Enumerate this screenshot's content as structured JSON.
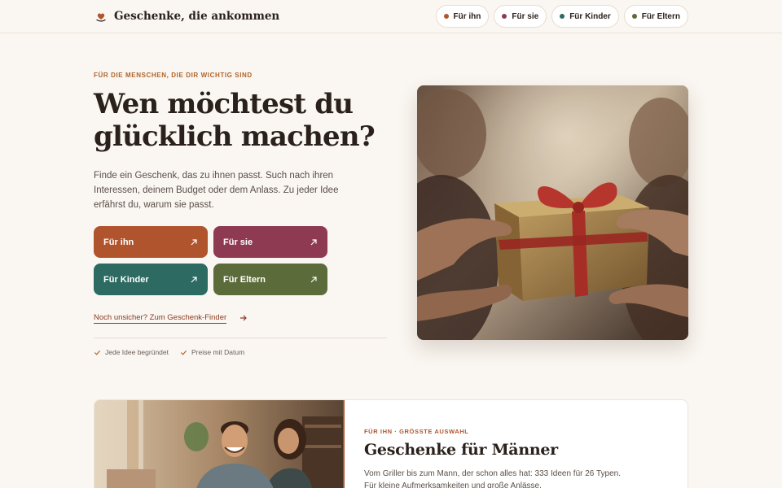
{
  "header": {
    "brand": "Geschenke, die ankommen",
    "nav": [
      {
        "label": "Für ihn",
        "color": "#b0542e"
      },
      {
        "label": "Für sie",
        "color": "#8e3a52"
      },
      {
        "label": "Für Kinder",
        "color": "#2d6a62"
      },
      {
        "label": "Für Eltern",
        "color": "#5c6b3a"
      }
    ]
  },
  "hero": {
    "eyebrow": "FÜR DIE MENSCHEN, DIE DIR WICHTIG SIND",
    "title_line1": "Wen möchtest du",
    "title_line2": "glücklich machen?",
    "intro": "Finde ein Geschenk, das zu ihnen passt. Such nach ihren Interessen, deinem Budget oder dem Anlass. Zu jeder Idee erfährst du, warum sie passt.",
    "ctas": [
      {
        "label": "Für ihn",
        "color": "#b0542e"
      },
      {
        "label": "Für sie",
        "color": "#8e3a52"
      },
      {
        "label": "Für Kinder",
        "color": "#2d6a62"
      },
      {
        "label": "Für Eltern",
        "color": "#5c6b3a"
      }
    ],
    "finder_link": "Noch unsicher? Zum Geschenk-Finder",
    "checks": [
      "Jede Idee begründet",
      "Preise mit Datum"
    ]
  },
  "card": {
    "eyebrow": "FÜR IHN · GRÖSSTE AUSWAHL",
    "title": "Geschenke für Männer",
    "text": "Vom Griller bis zum Mann, der schon alles hat: 333 Ideen für 26 Typen. Für kleine Aufmerksamkeiten und große Anlässe."
  }
}
